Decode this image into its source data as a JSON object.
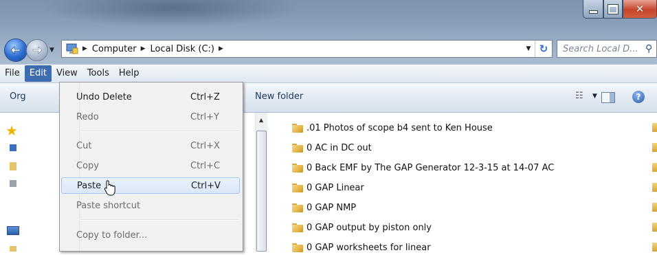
{
  "window": {
    "caption_buttons": [
      "minimize-icon",
      "maximize-icon",
      "close-icon"
    ]
  },
  "address_bar": {
    "breadcrumbs": [
      "Computer",
      "Local Disk (C:)"
    ],
    "search_placeholder": "Search Local D..."
  },
  "menubar": {
    "items": [
      "File",
      "Edit",
      "View",
      "Tools",
      "Help"
    ],
    "active": "Edit"
  },
  "commandbar": {
    "organize_label": "Org",
    "new_folder_label": "New folder"
  },
  "edit_menu": {
    "items": [
      {
        "label": "Undo Delete",
        "shortcut": "Ctrl+Z",
        "enabled": true
      },
      {
        "label": "Redo",
        "shortcut": "Ctrl+Y",
        "enabled": false
      },
      {
        "label": "Cut",
        "shortcut": "Ctrl+X",
        "enabled": false
      },
      {
        "label": "Copy",
        "shortcut": "Ctrl+C",
        "enabled": false
      },
      {
        "label": "Paste",
        "shortcut": "Ctrl+V",
        "enabled": true,
        "highlighted": true
      },
      {
        "label": "Paste shortcut",
        "shortcut": "",
        "enabled": false
      },
      {
        "label": "Copy to folder...",
        "shortcut": "",
        "enabled": false
      }
    ]
  },
  "files": [
    ".01 Photos of scope b4 sent to Ken House",
    "0 AC in DC out",
    "0 Back EMF by The GAP Generator 12-3-15 at 14-07 AC",
    "0 GAP Linear",
    "0 GAP NMP",
    "0 GAP output by piston only",
    "0 GAP worksheets for linear"
  ],
  "colors": {
    "menu_active_bg": "#3d6cb0",
    "highlight_border": "#a8c7ec",
    "folder_yellow": "#e3b54b"
  }
}
